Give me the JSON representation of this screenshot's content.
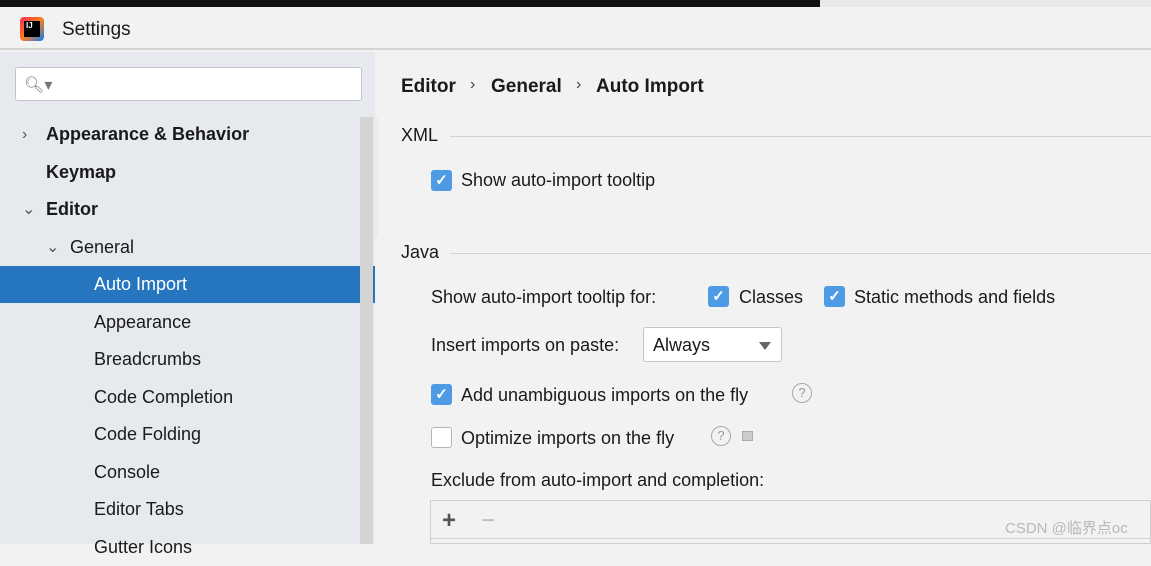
{
  "window": {
    "title": "Settings",
    "logo_text": "IJ"
  },
  "search": {
    "placeholder": "",
    "icon": "search-icon"
  },
  "tree": [
    {
      "label": "Appearance & Behavior",
      "bold": true,
      "arrow": "›",
      "level": 0
    },
    {
      "label": "Keymap",
      "bold": true,
      "arrow": "",
      "level": 0
    },
    {
      "label": "Editor",
      "bold": true,
      "arrow": "⌄",
      "level": 0
    },
    {
      "label": "General",
      "bold": false,
      "arrow": "⌄",
      "level": 1
    },
    {
      "label": "Auto Import",
      "bold": false,
      "level": 2,
      "selected": true
    },
    {
      "label": "Appearance",
      "level": 2
    },
    {
      "label": "Breadcrumbs",
      "level": 2
    },
    {
      "label": "Code Completion",
      "level": 2
    },
    {
      "label": "Code Folding",
      "level": 2
    },
    {
      "label": "Console",
      "level": 2
    },
    {
      "label": "Editor Tabs",
      "level": 2
    },
    {
      "label": "Gutter Icons",
      "level": 2
    }
  ],
  "breadcrumb": [
    "Editor",
    "General",
    "Auto Import"
  ],
  "xml": {
    "title": "XML",
    "show_tooltip": {
      "label": "Show auto-import tooltip",
      "checked": true
    }
  },
  "java": {
    "title": "Java",
    "tooltip_for_label": "Show auto-import tooltip for:",
    "classes": {
      "label": "Classes",
      "checked": true
    },
    "static": {
      "label": "Static methods and fields",
      "checked": true
    },
    "paste_label": "Insert imports on paste:",
    "paste_value": "Always",
    "unambiguous": {
      "label": "Add unambiguous imports on the fly",
      "checked": true
    },
    "optimize": {
      "label": "Optimize imports on the fly",
      "checked": false
    },
    "exclude_label": "Exclude from auto-import and completion:",
    "add": "+",
    "remove": "−"
  },
  "watermark": "CSDN @临界点oc",
  "colors": {
    "accent": "#2675bf",
    "checkbox": "#4d9be4"
  }
}
